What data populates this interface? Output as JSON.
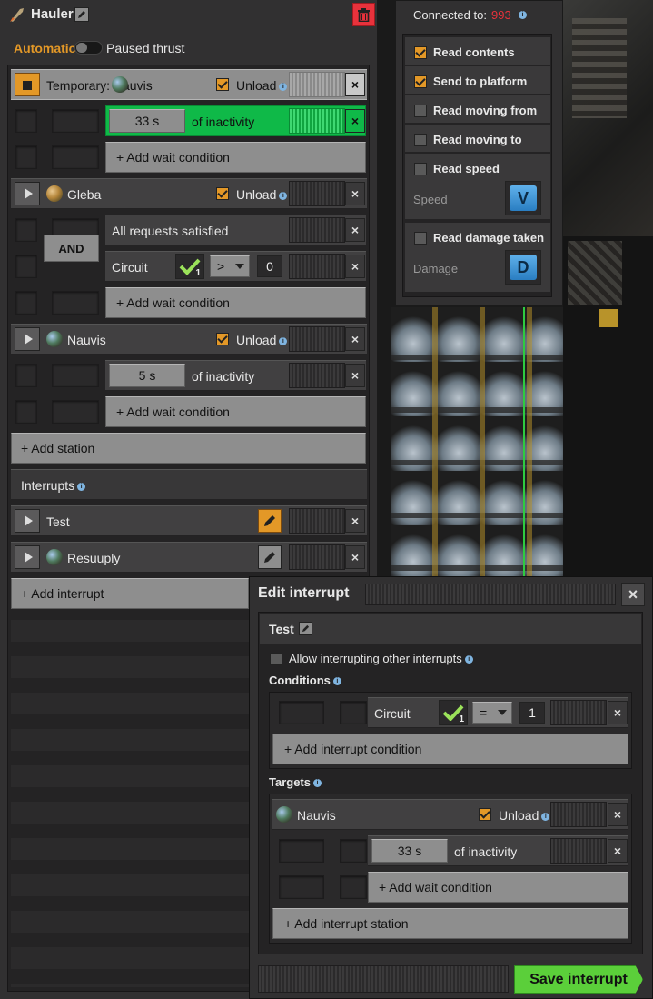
{
  "header": {
    "title": "Hauler",
    "automatic": "Automatic",
    "paused": "Paused thrust"
  },
  "schedule": {
    "stations": [
      {
        "name": "Temporary: Nauvis",
        "unload": "Unload",
        "wait": {
          "value": "33 s",
          "label": "of inactivity"
        },
        "add_wait": "+ Add wait condition"
      },
      {
        "name": "Gleba",
        "unload": "Unload",
        "and": "AND",
        "cond1": "All requests satisfied",
        "cond2": {
          "label": "Circuit",
          "count": "1",
          "op": ">",
          "value": "0"
        },
        "add_wait": "+ Add wait condition"
      },
      {
        "name": "Nauvis",
        "unload": "Unload",
        "wait": {
          "value": "5 s",
          "label": "of inactivity"
        },
        "add_wait": "+ Add wait condition"
      }
    ],
    "add_station": "+ Add station",
    "interrupts_title": "Interrupts",
    "interrupts": [
      {
        "name": "Test"
      },
      {
        "name": "Resuuply"
      }
    ],
    "add_interrupt": "+ Add interrupt"
  },
  "circuit": {
    "connected_label": "Connected to:",
    "connected_value": "993",
    "options": [
      {
        "label": "Read contents",
        "checked": true
      },
      {
        "label": "Send to platform",
        "checked": true
      },
      {
        "label": "Read moving from",
        "checked": false
      },
      {
        "label": "Read moving to",
        "checked": false
      },
      {
        "label": "Read speed",
        "checked": false
      },
      {
        "label": "Read damage taken",
        "checked": false
      }
    ],
    "speed_label": "Speed",
    "speed_signal": "V",
    "damage_label": "Damage",
    "damage_signal": "D"
  },
  "edit": {
    "title": "Edit interrupt",
    "name": "Test",
    "allow": "Allow interrupting other interrupts",
    "conditions_title": "Conditions",
    "condition": {
      "label": "Circuit",
      "count": "1",
      "op": "=",
      "value": "1"
    },
    "add_condition": "+ Add interrupt condition",
    "targets_title": "Targets",
    "target": {
      "name": "Nauvis",
      "unload": "Unload",
      "wait_value": "33 s",
      "wait_label": "of inactivity"
    },
    "add_wait": "+ Add wait condition",
    "add_station": "+ Add interrupt station",
    "save": "Save interrupt"
  },
  "colors": {
    "accent": "#e39827",
    "green": "#0fb948",
    "danger": "#e8323c",
    "link": "#7fb4e0"
  }
}
